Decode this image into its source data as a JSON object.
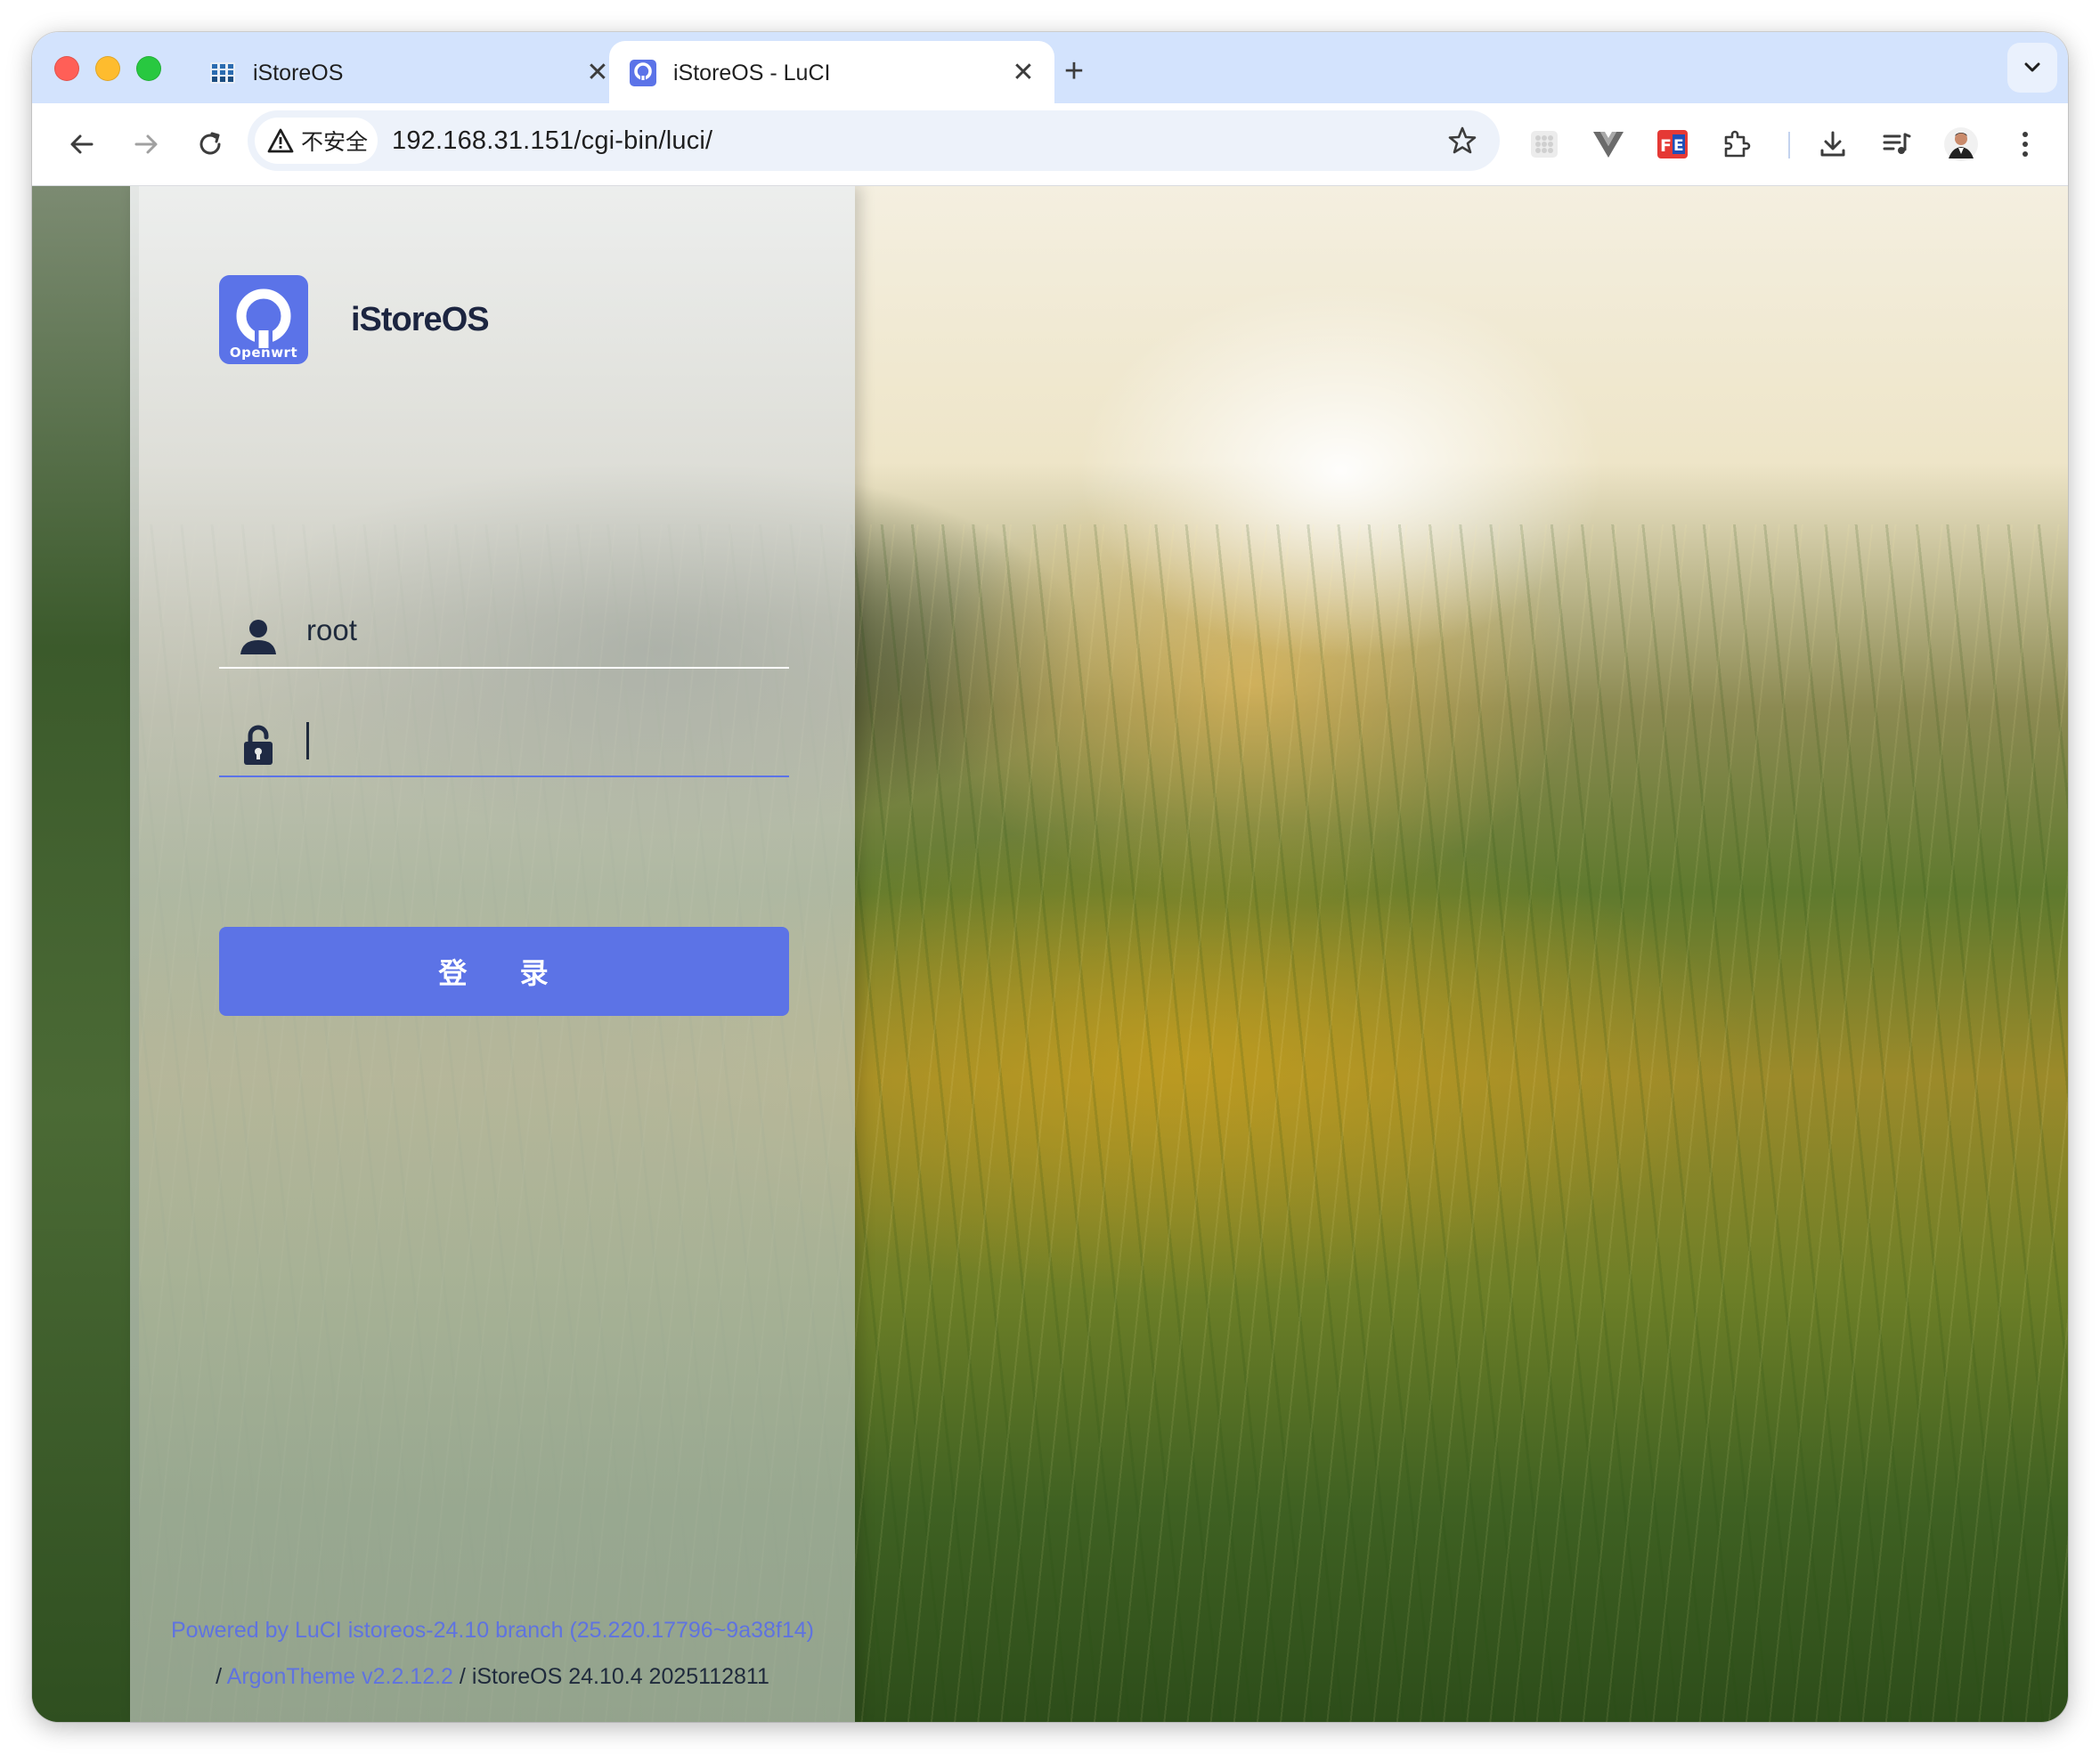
{
  "browser": {
    "tabs": [
      {
        "title": "iStoreOS",
        "active": false,
        "favicon": "grid-app-icon"
      },
      {
        "title": "iStoreOS - LuCI",
        "active": true,
        "favicon": "openwrt-icon"
      }
    ],
    "close_glyph": "✕",
    "new_tab_glyph": "+",
    "security_label": "不安全",
    "url": "192.168.31.151/cgi-bin/luci/",
    "accent_color": "#d3e3fd"
  },
  "login": {
    "logo_text": "Openwrt",
    "brand_name": "iStoreOS",
    "username": "root",
    "password": "",
    "button_label": "登 录",
    "button_color": "#5c73e6"
  },
  "footer": {
    "powered_by": "Powered by LuCI istoreos-24.10 branch (25.220.17796~9a38f14)",
    "sep1": "/",
    "theme_link": "ArgonTheme v2.2.12.2",
    "sep2": "/",
    "version": "iStoreOS 24.10.4 2025112811"
  }
}
